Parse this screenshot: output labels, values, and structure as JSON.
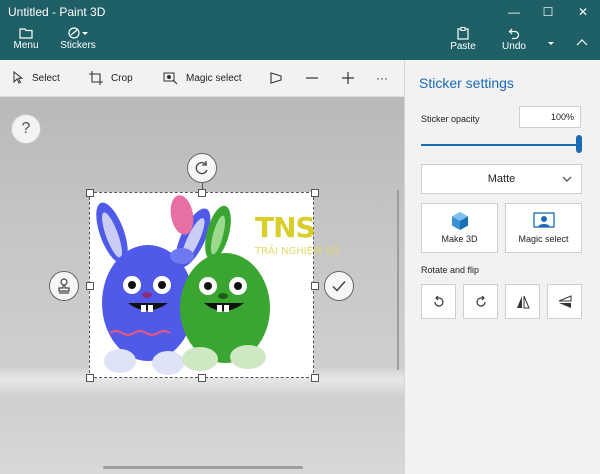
{
  "window": {
    "title": "Untitled - Paint 3D",
    "minimize": "—",
    "maximize": "☐",
    "close": "✕"
  },
  "toolbar": {
    "menu_label": "Menu",
    "stickers_label": "Stickers",
    "paste_label": "Paste",
    "undo_label": "Undo"
  },
  "commands": {
    "select_label": "Select",
    "crop_label": "Crop",
    "magic_select_label": "Magic select",
    "more": "···"
  },
  "canvas": {
    "help_symbol": "?"
  },
  "watermark": {
    "text": "TNS",
    "subtext": "TRẢI NGHIỆM SỐ"
  },
  "panel": {
    "title": "Sticker settings",
    "opacity_label": "Sticker opacity",
    "opacity_value": "100%",
    "opacity_level": 1.0,
    "finish_value": "Matte",
    "make3d_label": "Make 3D",
    "magic_select_label": "Magic select",
    "rotate_flip_label": "Rotate and flip"
  },
  "colors": {
    "accent": "#1a6bb5",
    "titlebar": "#1f5f66",
    "bunny_blue": "#4f5ae8",
    "bunny_green": "#3aa631"
  },
  "icons": [
    "menu-icon",
    "stickers-icon",
    "paste-icon",
    "undo-icon",
    "select-icon",
    "crop-icon",
    "magic-select-icon",
    "view-3d-icon",
    "zoom-out-icon",
    "zoom-in-icon",
    "rotate-icon",
    "stamp-icon",
    "check-icon",
    "cube-icon",
    "picture-icon",
    "rotate-left-icon",
    "rotate-right-icon",
    "flip-horizontal-icon",
    "flip-vertical-icon"
  ]
}
